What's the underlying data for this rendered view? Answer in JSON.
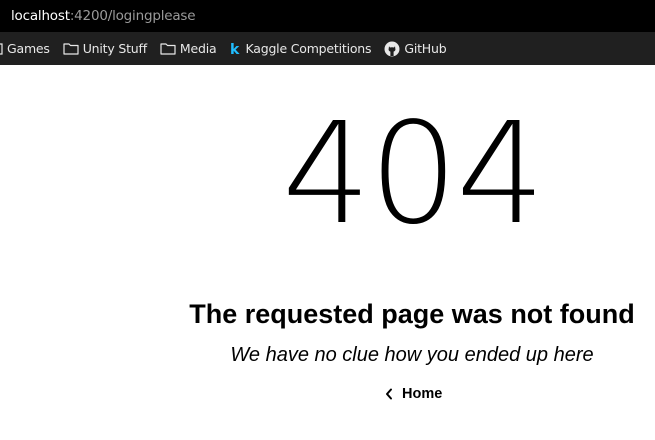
{
  "browser": {
    "url_host": "localhost",
    "url_rest": ":4200/logingplease",
    "bookmarks": [
      {
        "label": "Games",
        "icon": "folder-icon"
      },
      {
        "label": "Unity Stuff",
        "icon": "folder-icon"
      },
      {
        "label": "Media",
        "icon": "folder-icon"
      },
      {
        "label": "Kaggle Competitions",
        "icon": "kaggle-icon"
      },
      {
        "label": "GitHub",
        "icon": "github-icon"
      }
    ]
  },
  "page": {
    "code": "404",
    "title": "The requested page was not found",
    "subtitle": "We have no clue how you ended up here",
    "home_label": "Home"
  },
  "colors": {
    "address_bar_bg": "#000000",
    "bookmarks_bg": "#202020",
    "kaggle_blue": "#20beff",
    "text": "#000000"
  }
}
